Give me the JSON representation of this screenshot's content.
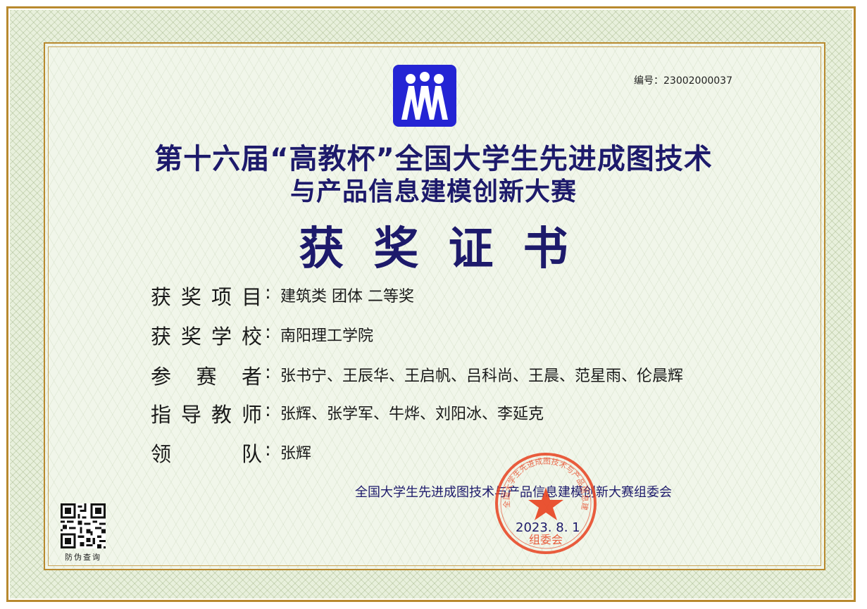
{
  "serial": {
    "label": "编号：",
    "number": "23002000037"
  },
  "title": {
    "line1": "第十六届“高教杯”全国大学生先进成图技术",
    "line2": "与产品信息建模创新大赛",
    "main": "获奖证书"
  },
  "fields": [
    {
      "label": "获奖项目",
      "value": "建筑类 团体 二等奖"
    },
    {
      "label": "获奖学校",
      "value": "南阳理工学院"
    },
    {
      "label": "参赛者",
      "value": "张书宁、王辰华、王启帆、吕科尚、王晨、范星雨、伦晨辉"
    },
    {
      "label": "指导教师",
      "value": "张辉、张学军、牛烨、刘阳冰、李延克"
    },
    {
      "label": "领队",
      "value": "张辉"
    }
  ],
  "colon": ":",
  "committee": "全国大学生先进成图技术与产品信息建模创新大赛组委会",
  "date": "2023. 8. 1",
  "seal": {
    "ring_text": "全国大学生先进成图技术与产品信息建模创新大赛",
    "center_text": "组委会"
  },
  "qr_caption": "防伪查询",
  "colors": {
    "title": "#1d1a6b",
    "seal": "#e8411e",
    "logo": "#2424d4",
    "frame": "#b8892e"
  }
}
